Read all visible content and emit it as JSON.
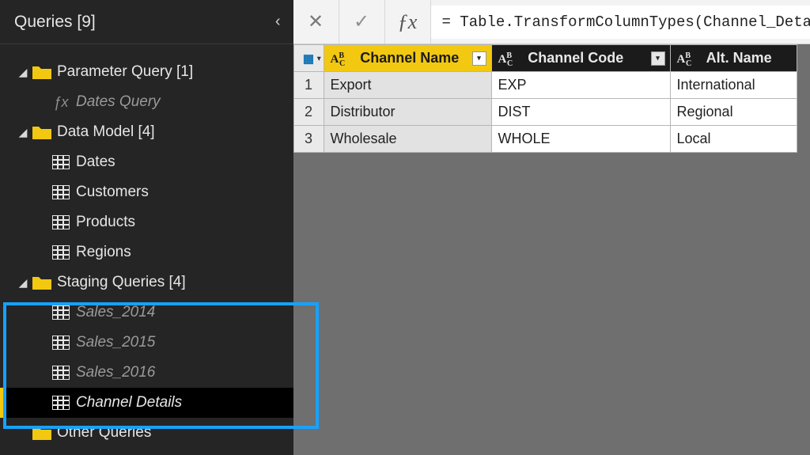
{
  "sidebar": {
    "title": "Queries [9]",
    "folders": [
      {
        "label": "Parameter Query [1]",
        "items": [
          {
            "label": "Dates Query",
            "type": "fx",
            "muted": true
          }
        ]
      },
      {
        "label": "Data Model [4]",
        "items": [
          {
            "label": "Dates",
            "type": "table"
          },
          {
            "label": "Customers",
            "type": "table"
          },
          {
            "label": "Products",
            "type": "table"
          },
          {
            "label": "Regions",
            "type": "table"
          }
        ]
      },
      {
        "label": "Staging Queries [4]",
        "items": [
          {
            "label": "Sales_2014",
            "type": "table",
            "muted": true
          },
          {
            "label": "Sales_2015",
            "type": "table",
            "muted": true
          },
          {
            "label": "Sales_2016",
            "type": "table",
            "muted": true
          },
          {
            "label": "Channel Details",
            "type": "table",
            "muted": false,
            "italic": true,
            "selected": true
          }
        ]
      },
      {
        "label": "Other Queries",
        "items": []
      }
    ]
  },
  "formula": {
    "text": "= Table.TransformColumnTypes(Channel_Deta"
  },
  "grid": {
    "columns": [
      {
        "header": "Channel Name",
        "selected": true
      },
      {
        "header": "Channel Code",
        "selected": false
      },
      {
        "header": "Alt. Name",
        "selected": false
      }
    ],
    "rows": [
      {
        "n": "1",
        "cells": [
          "Export",
          "EXP",
          "International"
        ]
      },
      {
        "n": "2",
        "cells": [
          "Distributor",
          "DIST",
          "Regional"
        ]
      },
      {
        "n": "3",
        "cells": [
          "Wholesale",
          "WHOLE",
          "Local"
        ]
      }
    ]
  }
}
